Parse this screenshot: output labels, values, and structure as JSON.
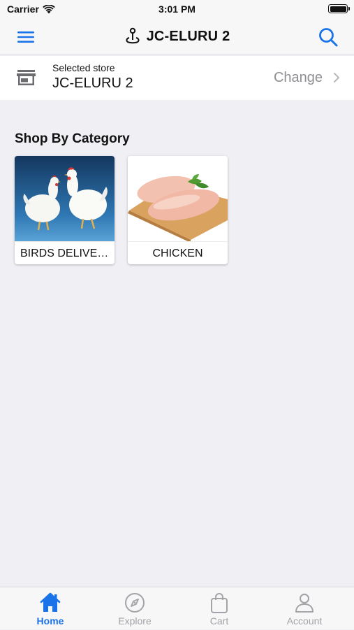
{
  "status_bar": {
    "carrier": "Carrier",
    "time": "3:01 PM"
  },
  "header": {
    "title": "JC-ELURU 2",
    "menu_icon": "hamburger-menu-icon",
    "location_icon": "location-pin-icon",
    "search_icon": "search-icon"
  },
  "store": {
    "caption": "Selected store",
    "name": "JC-ELURU 2",
    "change_label": "Change",
    "icon": "storefront-icon"
  },
  "categories": {
    "title": "Shop By Category",
    "items": [
      {
        "label": "BIRDS DELIVERY",
        "image": "white-hens-on-blue-background"
      },
      {
        "label": "CHICKEN",
        "image": "raw-chicken-breasts-on-board"
      }
    ]
  },
  "tabs": [
    {
      "label": "Home",
      "icon": "home-icon",
      "active": true
    },
    {
      "label": "Explore",
      "icon": "compass-icon",
      "active": false
    },
    {
      "label": "Cart",
      "icon": "shopping-bag-icon",
      "active": false
    },
    {
      "label": "Account",
      "icon": "person-icon",
      "active": false
    }
  ],
  "colors": {
    "accent": "#1a73e8",
    "inactive": "#a3a3a8",
    "background": "#efeff4"
  }
}
